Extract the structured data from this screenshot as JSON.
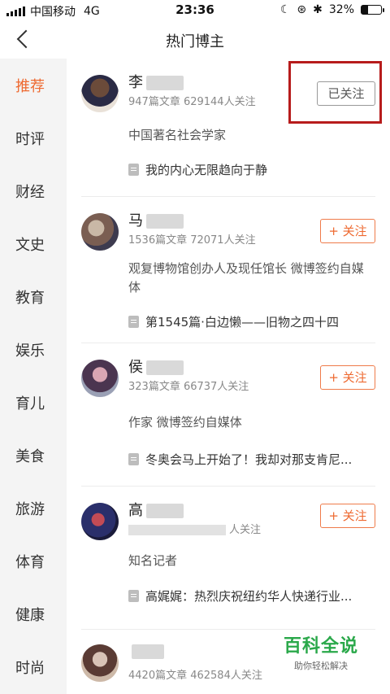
{
  "status": {
    "carrier": "中国移动",
    "network": "4G",
    "time": "23:36",
    "battery": "32%",
    "battery_level": 0.32
  },
  "nav": {
    "title": "热门博主"
  },
  "sidebar": {
    "items": [
      {
        "label": "推荐",
        "active": true
      },
      {
        "label": "时评"
      },
      {
        "label": "财经"
      },
      {
        "label": "文史"
      },
      {
        "label": "教育"
      },
      {
        "label": "娱乐"
      },
      {
        "label": "育儿"
      },
      {
        "label": "美食"
      },
      {
        "label": "旅游"
      },
      {
        "label": "体育"
      },
      {
        "label": "健康"
      },
      {
        "label": "时尚"
      }
    ]
  },
  "bloggers": [
    {
      "name": "李",
      "stats": "947篇文章  629144人关注",
      "desc": "中国著名社会学家",
      "post": "我的内心无限趋向于静",
      "button": "已关注",
      "followed": true
    },
    {
      "name": "马",
      "stats": "1536篇文章  72071人关注",
      "desc": "观复博物馆创办人及现任馆长 微博签约自媒体",
      "post": "第1545篇·白边懒——旧物之四十四",
      "button": "+ 关注",
      "followed": false
    },
    {
      "name": "侯",
      "stats": "323篇文章  66737人关注",
      "desc": "作家 微博签约自媒体",
      "post": "冬奥会马上开始了！我却对那支肯尼...",
      "button": "+ 关注",
      "followed": false
    },
    {
      "name": "高",
      "stats": "人关注",
      "desc": "知名记者",
      "post": "高娓娓：热烈庆祝纽约华人快递行业...",
      "button": "+ 关注",
      "followed": false
    },
    {
      "name": "",
      "stats": "4420篇文章  462584人关注",
      "desc": "",
      "post": "",
      "button": "+ 关注",
      "followed": false
    }
  ],
  "watermark": {
    "title": "百科全说",
    "subtitle": "助你轻松解决"
  },
  "colors": {
    "accent": "#ee6a31",
    "highlight": "#b71c1c",
    "watermark": "#2aa84a"
  }
}
